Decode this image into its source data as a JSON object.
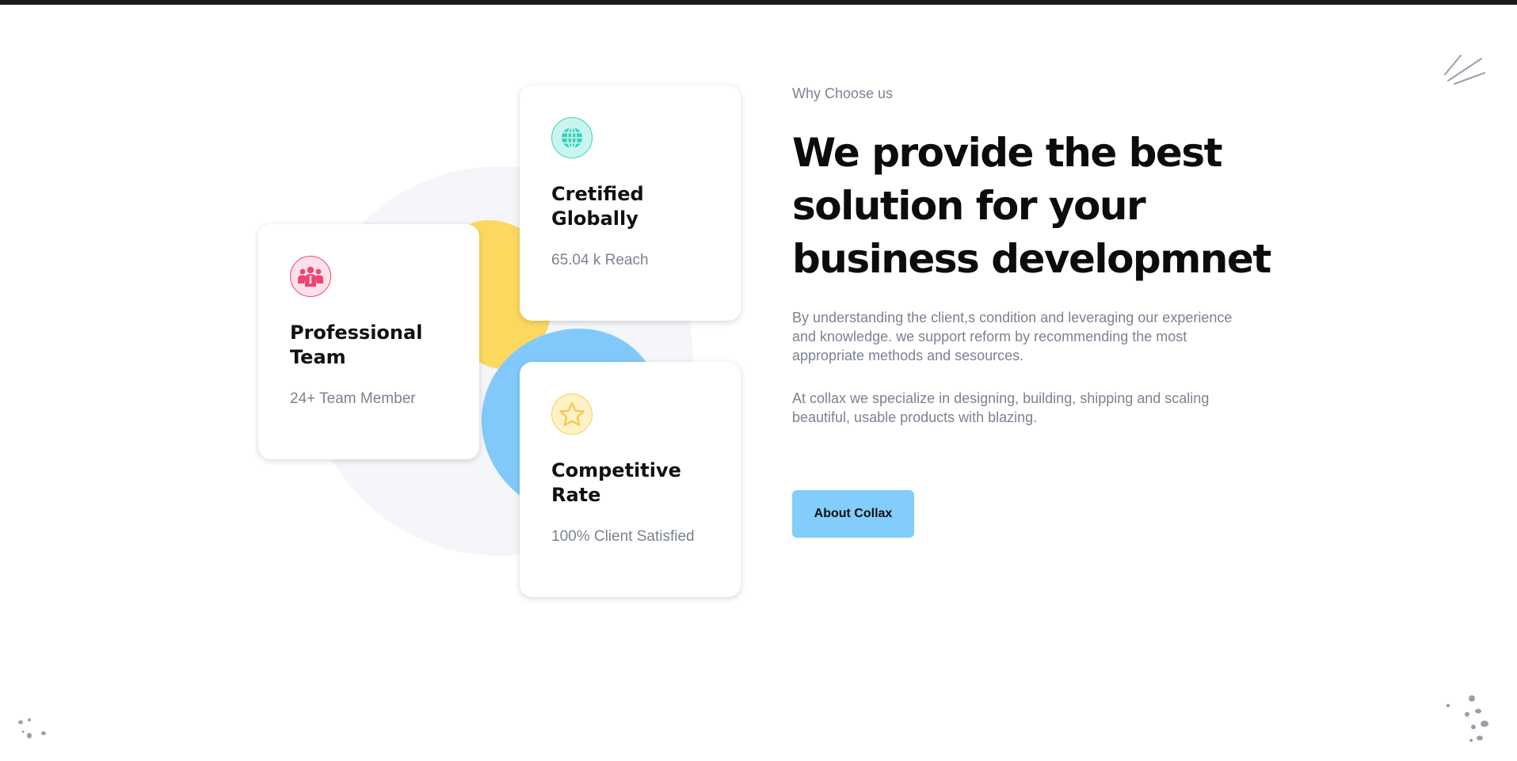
{
  "section": {
    "eyebrow": "Why Choose us",
    "headline": "We provide the best solution for your business developmnet",
    "paragraphs": [
      "By understanding the client,s condition and leveraging our experience and knowledge. we support reform by recommending the most appropriate methods and sesources.",
      "At collax we specialize in designing, building, shipping and scaling beautiful, usable products with blazing."
    ],
    "cta_label": "About Collax"
  },
  "cards": [
    {
      "title": "Professional Team",
      "subtitle": "24+ Team Member",
      "icon": "team-icon",
      "accent": "#f0456f"
    },
    {
      "title": "Cretified Globally",
      "subtitle": "65.04 k Reach",
      "icon": "globe-icon",
      "accent": "#2ed3b9"
    },
    {
      "title": "Competitive Rate",
      "subtitle": "100% Client Satisfied",
      "icon": "star-icon",
      "accent": "#f5cf5a"
    }
  ],
  "colors": {
    "accent_blue": "#82cdfb",
    "accent_yellow": "#fdd85f",
    "accent_pink": "#f0456f",
    "accent_teal": "#2ed3b9"
  }
}
